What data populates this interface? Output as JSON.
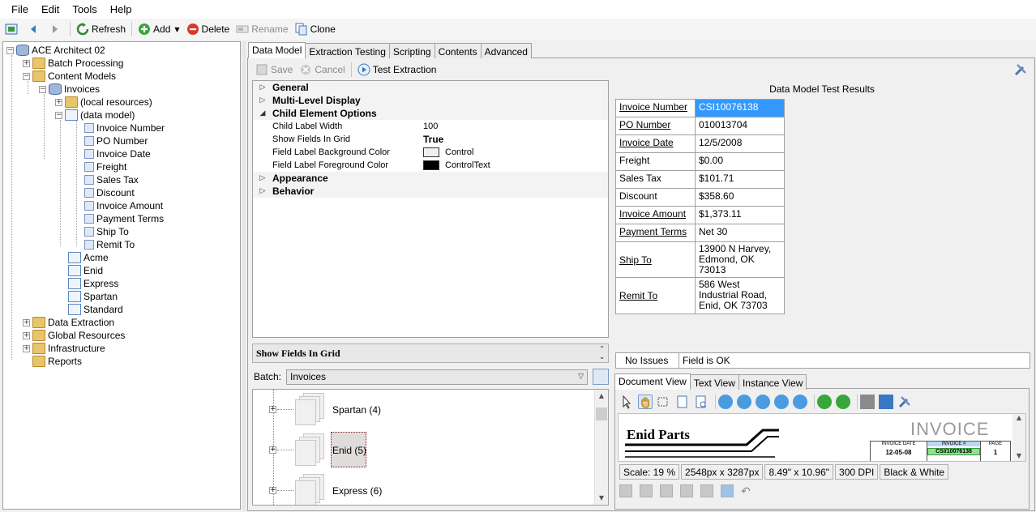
{
  "menu": [
    "File",
    "Edit",
    "Tools",
    "Help"
  ],
  "toolbar": {
    "refresh": "Refresh",
    "add": "Add",
    "delete": "Delete",
    "rename": "Rename",
    "clone": "Clone"
  },
  "tree": {
    "root": "ACE Architect 02",
    "batch_processing": "Batch Processing",
    "content_models": "Content Models",
    "invoices": "Invoices",
    "local_resources": "(local resources)",
    "data_model": "(data model)",
    "fields": [
      "Invoice Number",
      "PO Number",
      "Invoice Date",
      "Freight",
      "Sales Tax",
      "Discount",
      "Invoice Amount",
      "Payment Terms",
      "Ship To",
      "Remit To"
    ],
    "instances": [
      "Acme",
      "Enid",
      "Express",
      "Spartan",
      "Standard"
    ],
    "others": [
      "Data Extraction",
      "Global Resources",
      "Infrastructure",
      "Reports"
    ]
  },
  "tabs": [
    "Data Model",
    "Extraction Testing",
    "Scripting",
    "Contents",
    "Advanced"
  ],
  "subtoolbar": {
    "save": "Save",
    "cancel": "Cancel",
    "test": "Test Extraction"
  },
  "propgrid": {
    "general": "General",
    "multilevel": "Multi-Level Display",
    "child_options": "Child Element Options",
    "rows": [
      {
        "name": "Child Label Width",
        "value": "100"
      },
      {
        "name": "Show Fields In Grid",
        "value": "True"
      },
      {
        "name": "Field Label Background Color",
        "value": "Control",
        "swatch": "#f0f0f0"
      },
      {
        "name": "Field Label Foreground Color",
        "value": "ControlText",
        "swatch": "#000000"
      }
    ],
    "appearance": "Appearance",
    "behavior": "Behavior",
    "description_title": "Show Fields In Grid"
  },
  "batch": {
    "label": "Batch:",
    "selected": "Invoices",
    "items": [
      {
        "label": "Spartan (4)"
      },
      {
        "label": "Enid (5)"
      },
      {
        "label": "Express (6)"
      }
    ]
  },
  "results": {
    "title": "Data Model Test Results",
    "rows": [
      {
        "label": "Invoice Number",
        "value": "CSI10076138"
      },
      {
        "label": "PO Number",
        "value": "010013704"
      },
      {
        "label": "Invoice Date",
        "value": "12/5/2008"
      },
      {
        "label": "Freight",
        "value": "$0.00"
      },
      {
        "label": "Sales Tax",
        "value": "$101.71"
      },
      {
        "label": "Discount",
        "value": "$358.60"
      },
      {
        "label": "Invoice Amount",
        "value": "$1,373.11"
      },
      {
        "label": "Payment Terms",
        "value": "Net 30"
      },
      {
        "label": "Ship To",
        "value": "13900 N Harvey, Edmond, OK 73013"
      },
      {
        "label": "Remit To",
        "value": "586 West Industrial Road, Enid, OK 73703"
      }
    ]
  },
  "status": {
    "issues": "No Issues",
    "field": "Field is OK"
  },
  "doc_tabs": [
    "Document View",
    "Text View",
    "Instance View"
  ],
  "document": {
    "company": "Enid Parts",
    "doc_title": "INVOICE",
    "invoice_date_label": "INVOICE DATE",
    "invoice_date": "12-05-08",
    "invoice_no_label": "INVOICE #",
    "invoice_no": "CSI/10076138",
    "page_label": "PAGE",
    "page": "1"
  },
  "doc_status": {
    "scale": "Scale: 19 %",
    "pixels": "2548px x 3287px",
    "inches": "8.49\" x 10.96\"",
    "dpi": "300 DPI",
    "color": "Black & White"
  }
}
